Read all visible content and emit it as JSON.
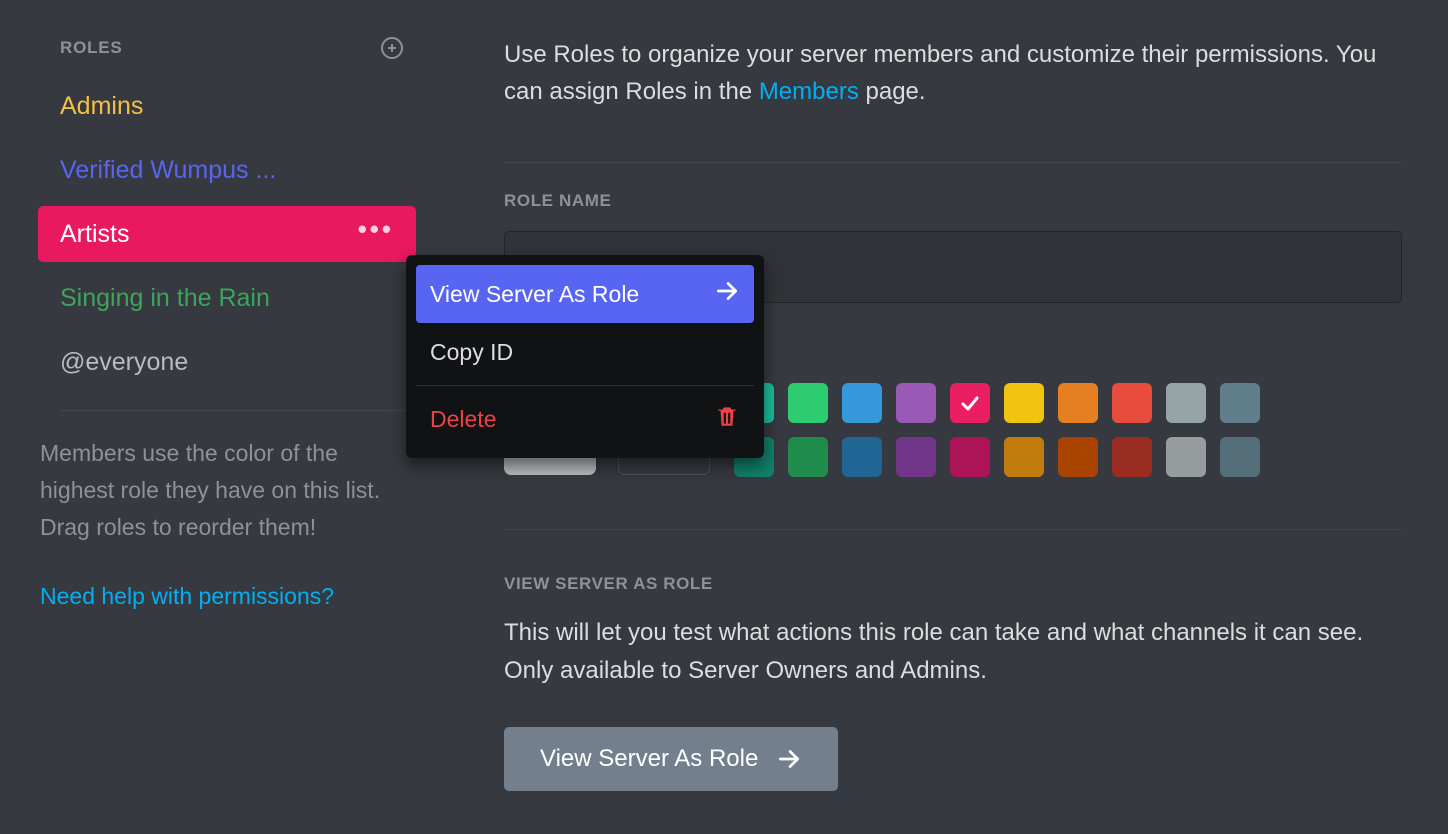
{
  "sidebar": {
    "title": "ROLES",
    "roles": [
      {
        "label": "Admins",
        "color": "#f4c044",
        "selected": false
      },
      {
        "label": "Verified Wumpus ...",
        "color": "#5865f2",
        "selected": false
      },
      {
        "label": "Artists",
        "color": "#ffffff",
        "selected": true
      },
      {
        "label": "Singing in the Rain",
        "color": "#3ba55c",
        "selected": false
      },
      {
        "label": "@everyone",
        "color": "#b9bbbe",
        "selected": false,
        "everyone": true
      }
    ],
    "note": "Members use the color of the highest role they have on this list. Drag roles to reorder them!",
    "help": "Need help with permissions?"
  },
  "content": {
    "intro_pre": "Use Roles to organize your server members and customize their permissions. You can assign Roles in the ",
    "intro_link": "Members",
    "intro_post": " page.",
    "role_name_label": "ROLE NAME",
    "role_name_value": "",
    "colors": {
      "current": "#b9bbbe",
      "row1": [
        "#1abc9c",
        "#2ecc71",
        "#3498db",
        "#9b59b6",
        "#e91e63",
        "#f1c40f",
        "#e67e22",
        "#e74c3c",
        "#95a5a6",
        "#607d8b"
      ],
      "row2": [
        "#11806a",
        "#1f8b4c",
        "#206694",
        "#71368a",
        "#ad1457",
        "#c27c0e",
        "#a84300",
        "#992d22",
        "#979c9f",
        "#546e7a"
      ],
      "selected_index": 4
    },
    "view_label": "VIEW SERVER AS ROLE",
    "view_desc": "This will let you test what actions this role can take and what channels it can see. Only available to Server Owners and Admins.",
    "view_button": "View Server As Role"
  },
  "context": {
    "items": [
      {
        "label": "View Server As Role",
        "icon": "arrow",
        "highlight": true
      },
      {
        "label": "Copy ID"
      },
      {
        "label": "Delete",
        "icon": "trash",
        "danger": true
      }
    ]
  }
}
